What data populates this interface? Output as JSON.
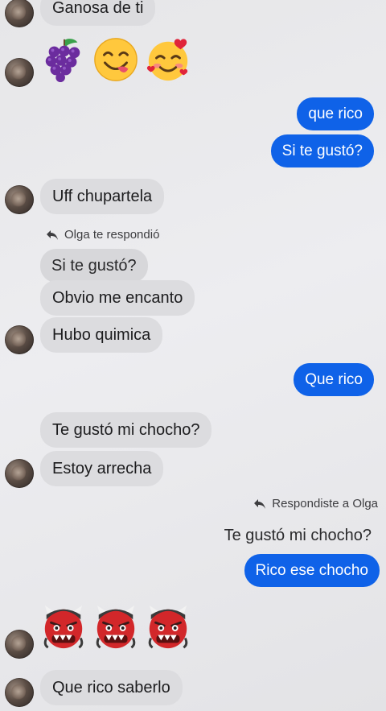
{
  "conversation": {
    "messages": [
      {
        "id": "m1",
        "direction": "in",
        "text": "Ganosa de ti"
      },
      {
        "id": "m2",
        "direction": "in",
        "emojis": [
          "grapes-emoji",
          "savoring-face-emoji",
          "smiling-face-with-hearts-emoji"
        ]
      },
      {
        "id": "m3",
        "direction": "out",
        "text": "que rico"
      },
      {
        "id": "m4",
        "direction": "out",
        "text": "Si te gustó?"
      },
      {
        "id": "m5",
        "direction": "in",
        "text": "Uff chupartela"
      },
      {
        "id": "m6",
        "direction": "in",
        "reply_label": "Olga te respondió",
        "quoted_text": "Si te gustó?"
      },
      {
        "id": "m7",
        "direction": "in",
        "text": "Obvio me encanto"
      },
      {
        "id": "m8",
        "direction": "in",
        "text": "Hubo quimica"
      },
      {
        "id": "m9",
        "direction": "out",
        "text": "Que rico"
      },
      {
        "id": "m10",
        "direction": "in",
        "text": "Te gustó mi chocho?"
      },
      {
        "id": "m11",
        "direction": "in",
        "text": "Estoy arrecha"
      },
      {
        "id": "m12",
        "direction": "out",
        "reply_label": "Respondiste a Olga",
        "quoted_text": "Te gustó mi chocho?"
      },
      {
        "id": "m13",
        "direction": "out",
        "text": "Rico ese chocho"
      },
      {
        "id": "m14",
        "direction": "in",
        "emojis": [
          "ogre-emoji",
          "ogre-emoji",
          "ogre-emoji"
        ]
      },
      {
        "id": "m15",
        "direction": "in",
        "text": "Que rico saberlo"
      }
    ]
  },
  "colors": {
    "outgoing_bubble": "#0f62e8",
    "incoming_bubble": "#dcdcdf",
    "background": "#e8e8eb"
  }
}
